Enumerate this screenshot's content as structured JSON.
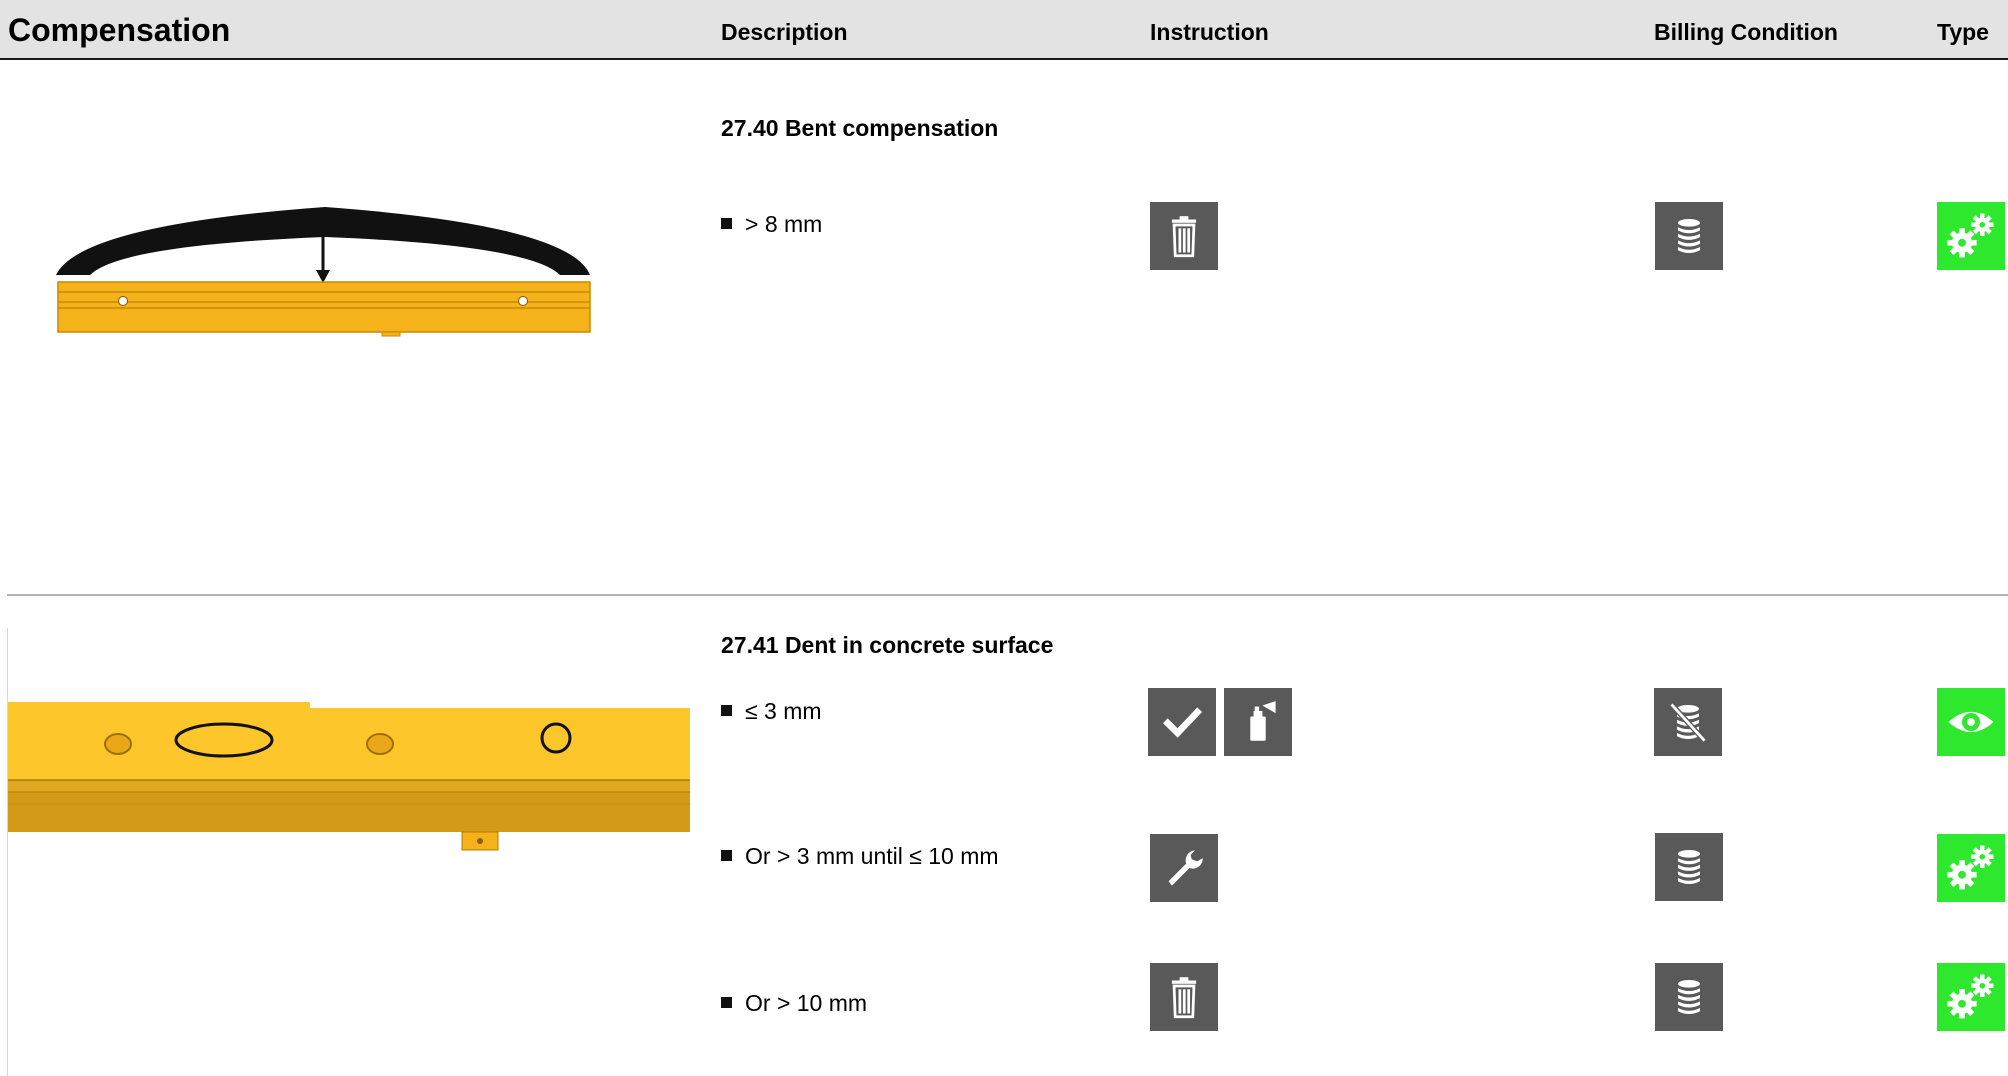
{
  "header": {
    "title": "Compensation",
    "col_description": "Description",
    "col_instruction": "Instruction",
    "col_billing": "Billing Condition",
    "col_type": "Type"
  },
  "sections": [
    {
      "title": "27.40 Bent compensation",
      "rows": [
        {
          "text": "> 8 mm",
          "instruction_icons": [
            "trash-icon"
          ],
          "billing_icon": "coin-stack-icon",
          "type_icon": "gears-icon"
        }
      ]
    },
    {
      "title": "27.41 Dent in concrete surface",
      "rows": [
        {
          "text": "≤ 3 mm",
          "instruction_icons": [
            "checkmark-icon",
            "spray-can-icon"
          ],
          "billing_icon": "coin-stack-crossed-icon",
          "type_icon": "eye-icon"
        },
        {
          "text": "Or > 3 mm until ≤ 10 mm",
          "instruction_icons": [
            "wrench-icon"
          ],
          "billing_icon": "coin-stack-icon",
          "type_icon": "gears-icon"
        },
        {
          "text": "Or > 10 mm",
          "instruction_icons": [
            "trash-icon"
          ],
          "billing_icon": "coin-stack-icon",
          "type_icon": "gears-icon"
        }
      ]
    }
  ],
  "colors": {
    "icon_gray": "#595959",
    "type_green": "#2ee82e",
    "part_yellow": "#f5b21b",
    "header_bg": "#e3e3e3"
  }
}
